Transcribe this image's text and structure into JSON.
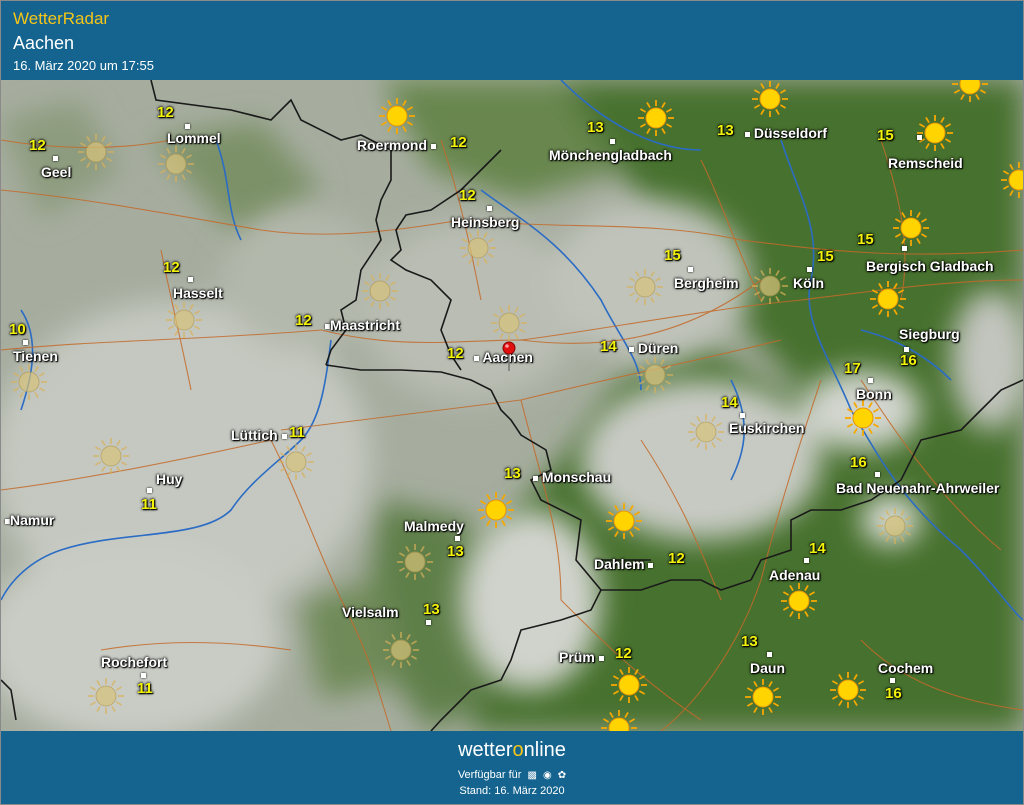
{
  "header": {
    "brand": "WetterRadar",
    "location": "Aachen",
    "timestamp": "16. März 2020 um 17:55"
  },
  "colors": {
    "header_bg": "#14648f",
    "brand_yellow": "#f5c518",
    "temp_yellow": "#f2f20a",
    "forest_green": "#3f6a2c",
    "cloud_grey": "#b8bdb4",
    "border_line": "#1a1a1a",
    "road_line": "#c46a2a",
    "river_line": "#2b6cc4"
  },
  "map": {
    "pin_icon": "map-pin-icon",
    "sun_icon": "sun-icon",
    "cities": [
      {
        "name": "Lommel"
      },
      {
        "name": "Geel"
      },
      {
        "name": "Roermond"
      },
      {
        "name": "Mönchengladbach"
      },
      {
        "name": "Düsseldorf"
      },
      {
        "name": "Remscheid"
      },
      {
        "name": "Heinsberg"
      },
      {
        "name": "Hasselt"
      },
      {
        "name": "Maastricht"
      },
      {
        "name": "Aachen"
      },
      {
        "name": "Tienen"
      },
      {
        "name": "Bergheim"
      },
      {
        "name": "Köln"
      },
      {
        "name": "Bergisch Gladbach"
      },
      {
        "name": "Düren"
      },
      {
        "name": "Siegburg"
      },
      {
        "name": "Bonn"
      },
      {
        "name": "Lüttich"
      },
      {
        "name": "Euskirchen"
      },
      {
        "name": "Huy"
      },
      {
        "name": "Monschau"
      },
      {
        "name": "Bad Neuenahr-Ahrweiler"
      },
      {
        "name": "Namur"
      },
      {
        "name": "Malmedy"
      },
      {
        "name": "Dahlem"
      },
      {
        "name": "Adenau"
      },
      {
        "name": "Vielsalm"
      },
      {
        "name": "Rochefort"
      },
      {
        "name": "Prüm"
      },
      {
        "name": "Daun"
      },
      {
        "name": "Cochem"
      }
    ],
    "temperatures": [
      "12",
      "12",
      "12",
      "13",
      "13",
      "15",
      "12",
      "12",
      "12",
      "12",
      "10",
      "15",
      "15",
      "15",
      "14",
      "16",
      "17",
      "11",
      "14",
      "11",
      "13",
      "16",
      "13",
      "12",
      "14",
      "13",
      "11",
      "12",
      "13",
      "16"
    ]
  },
  "footer": {
    "logo_part1": "wetter",
    "logo_part2": "o",
    "logo_part3": "nline",
    "available": "Verfügbar für",
    "os_icons": [
      "android-icon",
      "apple-icon",
      "windows-icon"
    ],
    "stand": "Stand: 16. März 2020"
  }
}
